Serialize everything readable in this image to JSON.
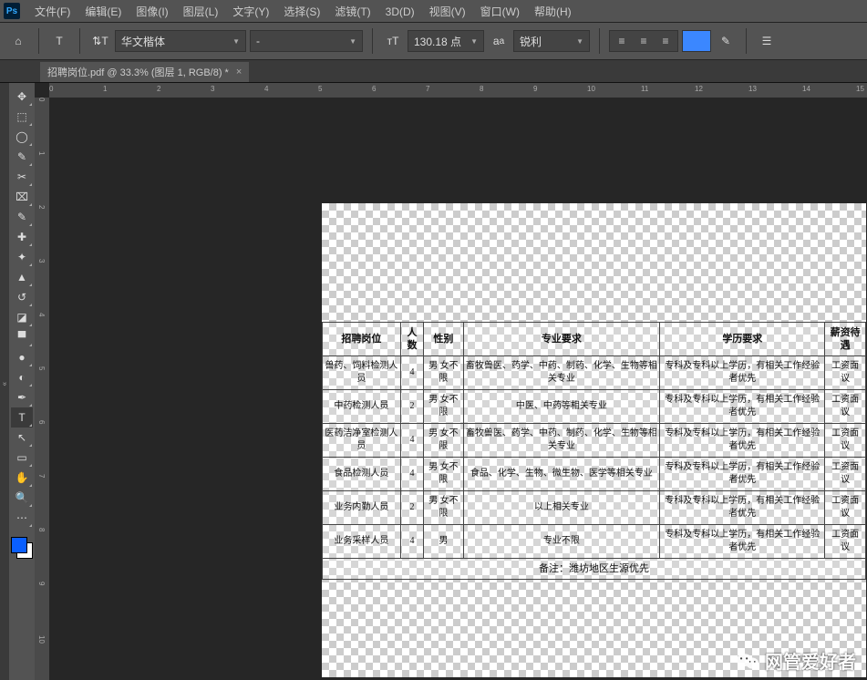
{
  "menu": {
    "items": [
      "文件(F)",
      "编辑(E)",
      "图像(I)",
      "图层(L)",
      "文字(Y)",
      "选择(S)",
      "滤镜(T)",
      "3D(D)",
      "视图(V)",
      "窗口(W)",
      "帮助(H)"
    ]
  },
  "opt": {
    "font": "华文楷体",
    "weight": "-",
    "size": "130.18 点",
    "aa": "锐利"
  },
  "tab": {
    "title": "招聘岗位.pdf @ 33.3% (图层 1, RGB/8) *"
  },
  "ruler_h": [
    "0",
    "1",
    "2",
    "3",
    "4",
    "5",
    "6",
    "7",
    "8",
    "9",
    "10",
    "11",
    "12",
    "13",
    "14",
    "15"
  ],
  "ruler_v": [
    "0",
    "1",
    "2",
    "3",
    "4",
    "5",
    "6",
    "7",
    "8",
    "9",
    "10"
  ],
  "tools": [
    {
      "name": "move-tool",
      "g": "✥"
    },
    {
      "name": "marquee-tool",
      "g": "⬚"
    },
    {
      "name": "lasso-tool",
      "g": "◯"
    },
    {
      "name": "quick-select-tool",
      "g": "✎"
    },
    {
      "name": "crop-tool",
      "g": "✂"
    },
    {
      "name": "frame-tool",
      "g": "⌧"
    },
    {
      "name": "eyedropper-tool",
      "g": "✎"
    },
    {
      "name": "heal-tool",
      "g": "✚"
    },
    {
      "name": "brush-tool",
      "g": "✦"
    },
    {
      "name": "stamp-tool",
      "g": "▲"
    },
    {
      "name": "history-brush-tool",
      "g": "↺"
    },
    {
      "name": "eraser-tool",
      "g": "◪"
    },
    {
      "name": "gradient-tool",
      "g": "▀"
    },
    {
      "name": "blur-tool",
      "g": "●"
    },
    {
      "name": "dodge-tool",
      "g": "◐"
    },
    {
      "name": "pen-tool",
      "g": "✒"
    },
    {
      "name": "type-tool",
      "g": "T",
      "active": true
    },
    {
      "name": "path-select-tool",
      "g": "↖"
    },
    {
      "name": "shape-tool",
      "g": "▭"
    },
    {
      "name": "hand-tool",
      "g": "✋"
    },
    {
      "name": "zoom-tool",
      "g": "🔍"
    },
    {
      "name": "more-tool",
      "g": "⋯"
    }
  ],
  "table": {
    "head": [
      "招聘岗位",
      "人数",
      "性别",
      "专业要求",
      "学历要求",
      "薪资待遇"
    ],
    "rows": [
      [
        "兽药、饲料检测人员",
        "4",
        "男 女不限",
        "畜牧兽医、药学、中药、制药、化学、生物等相关专业",
        "专科及专科以上学历，有相关工作经验者优先",
        "工资面议"
      ],
      [
        "中药检测人员",
        "2",
        "男 女不限",
        "中医、中药等相关专业",
        "专科及专科以上学历，有相关工作经验者优先",
        "工资面议"
      ],
      [
        "医药洁净室检测人员",
        "4",
        "男 女不限",
        "畜牧兽医、药学、中药、制药、化学、生物等相关专业",
        "专科及专科以上学历，有相关工作经验者优先",
        "工资面议"
      ],
      [
        "食品检测人员",
        "4",
        "男 女不限",
        "食品、化学、生物、微生物、医学等相关专业",
        "专科及专科以上学历，有相关工作经验者优先",
        "工资面议"
      ],
      [
        "业务内勤人员",
        "2",
        "男 女不限",
        "以上相关专业",
        "专科及专科以上学历，有相关工作经验者优先",
        "工资面议"
      ],
      [
        "业务采样人员",
        "4",
        "男",
        "专业不限",
        "专科及专科以上学历，有相关工作经验者优先",
        "工资面议"
      ]
    ],
    "note": "备注：潍坊地区生源优先"
  },
  "watermark": "网管爱好者"
}
